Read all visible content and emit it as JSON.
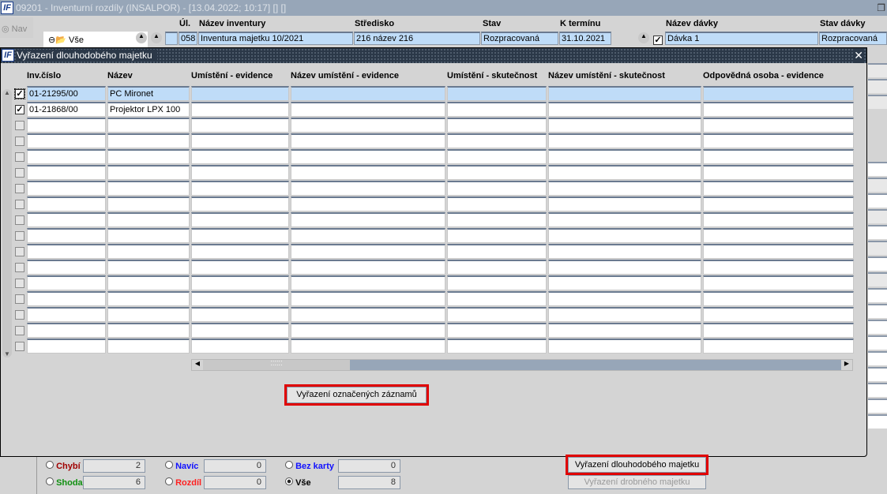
{
  "window": {
    "title": "09201 - Inventurní rozdíly (INSALPOR) - [13.04.2022; 10:17]  []  []",
    "logo": "IF"
  },
  "nav": {
    "label": "Nav",
    "tree_root": "Vše"
  },
  "inventory": {
    "headers": [
      "Úl.",
      "Název inventury",
      "Středisko",
      "Stav",
      "K termínu"
    ],
    "row": {
      "ul": "058",
      "nazev": "Inventura majetku 10/2021",
      "stredisko": "216 název 216",
      "stav": "Rozpracovaná",
      "termin": "31.10.2021"
    }
  },
  "batch": {
    "headers": [
      "Název dávky",
      "Stav dávky"
    ],
    "row": {
      "checked": true,
      "nazev": "Dávka 1",
      "stav": "Rozpracovaná"
    }
  },
  "dialog": {
    "title": "Vyřazení dlouhodobého majetku",
    "close": "✕",
    "columns": [
      "Inv.číslo",
      "Název",
      "Umístění - evidence",
      "Název umístění - evidence",
      "Umístění - skutečnost",
      "Název umístění - skutečnost",
      "Odpovědná osoba - evidence"
    ],
    "rows": [
      {
        "checked": true,
        "inv": "01-21295/00",
        "nazev": "PC Mironet"
      },
      {
        "checked": true,
        "inv": "01-21868/00",
        "nazev": "Projektor LPX 100"
      }
    ],
    "empty_rows": 15,
    "button": "Vyřazení označených záznamů"
  },
  "filters": [
    {
      "label": "Chybí",
      "value": "2",
      "color": "#a00000",
      "selected": false
    },
    {
      "label": "Navíc",
      "value": "0",
      "color": "#1010ff",
      "selected": false
    },
    {
      "label": "Bez karty",
      "value": "0",
      "color": "#1010ff",
      "selected": false
    },
    {
      "label": "Shoda",
      "value": "6",
      "color": "#109010",
      "selected": false
    },
    {
      "label": "Rozdíl",
      "value": "0",
      "color": "#ff2020",
      "selected": false
    },
    {
      "label": "Vše",
      "value": "8",
      "color": "#000000",
      "selected": true
    }
  ],
  "actions": {
    "long_term": "Vyřazení dlouhodobého majetku",
    "small": "Vyřazení drobného majetku"
  }
}
